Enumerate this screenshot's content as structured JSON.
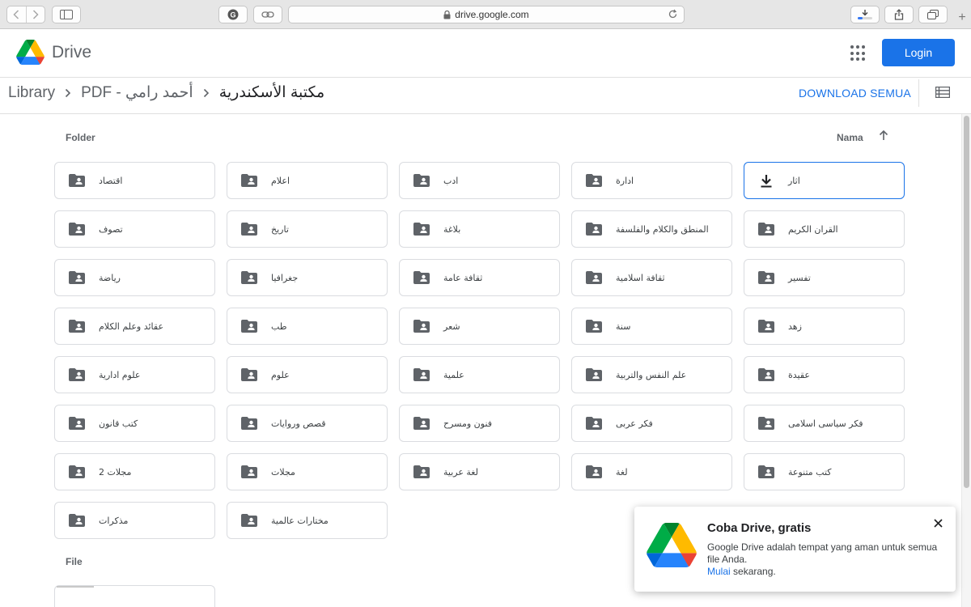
{
  "browser": {
    "url": "drive.google.com"
  },
  "header": {
    "app_name": "Drive",
    "login_label": "Login"
  },
  "breadcrumb": {
    "root": "Library",
    "parent": "أحمد رامي - PDF",
    "current": "مكتبة الأسكندرية"
  },
  "toolbar": {
    "download_all_label": "DOWNLOAD SEMUA"
  },
  "sections": {
    "folder_label": "Folder",
    "sort_label": "Nama",
    "file_label": "File"
  },
  "folders": [
    "اقتصاد",
    "اعلام",
    "ادب",
    "ادارة",
    "اثار",
    "تصوف",
    "تاريخ",
    "بلاغة",
    "المنطق والكلام والفلسفة",
    "القران الكريم",
    "رياضة",
    "جغرافيا",
    "ثقافة عامة",
    "ثقافة اسلامية",
    "تفسير",
    "عقائد وعلم الكلام",
    "طب",
    "شعر",
    "سنة",
    "زهد",
    "علوم ادارية",
    "علوم",
    "علمية",
    "علم النفس والتربية",
    "عقيدة",
    "كتب قانون",
    "قصص وروايات",
    "فنون ومسرح",
    "فكر عربى",
    "فكر سياسى اسلامى",
    "مجلات 2",
    "مجلات",
    "لغة عربية",
    "لغة",
    "كتب متنوعة",
    "مذكرات",
    "مختارات عالمية"
  ],
  "selected_folder": "اثار",
  "promo": {
    "title": "Coba Drive, gratis",
    "body": "Google Drive adalah tempat yang aman untuk semua file Anda.",
    "link_text": "Mulai",
    "link_suffix": " sekarang."
  },
  "colors": {
    "accent": "#1a73e8",
    "border": "#dadce0",
    "icon": "#5f6368"
  }
}
